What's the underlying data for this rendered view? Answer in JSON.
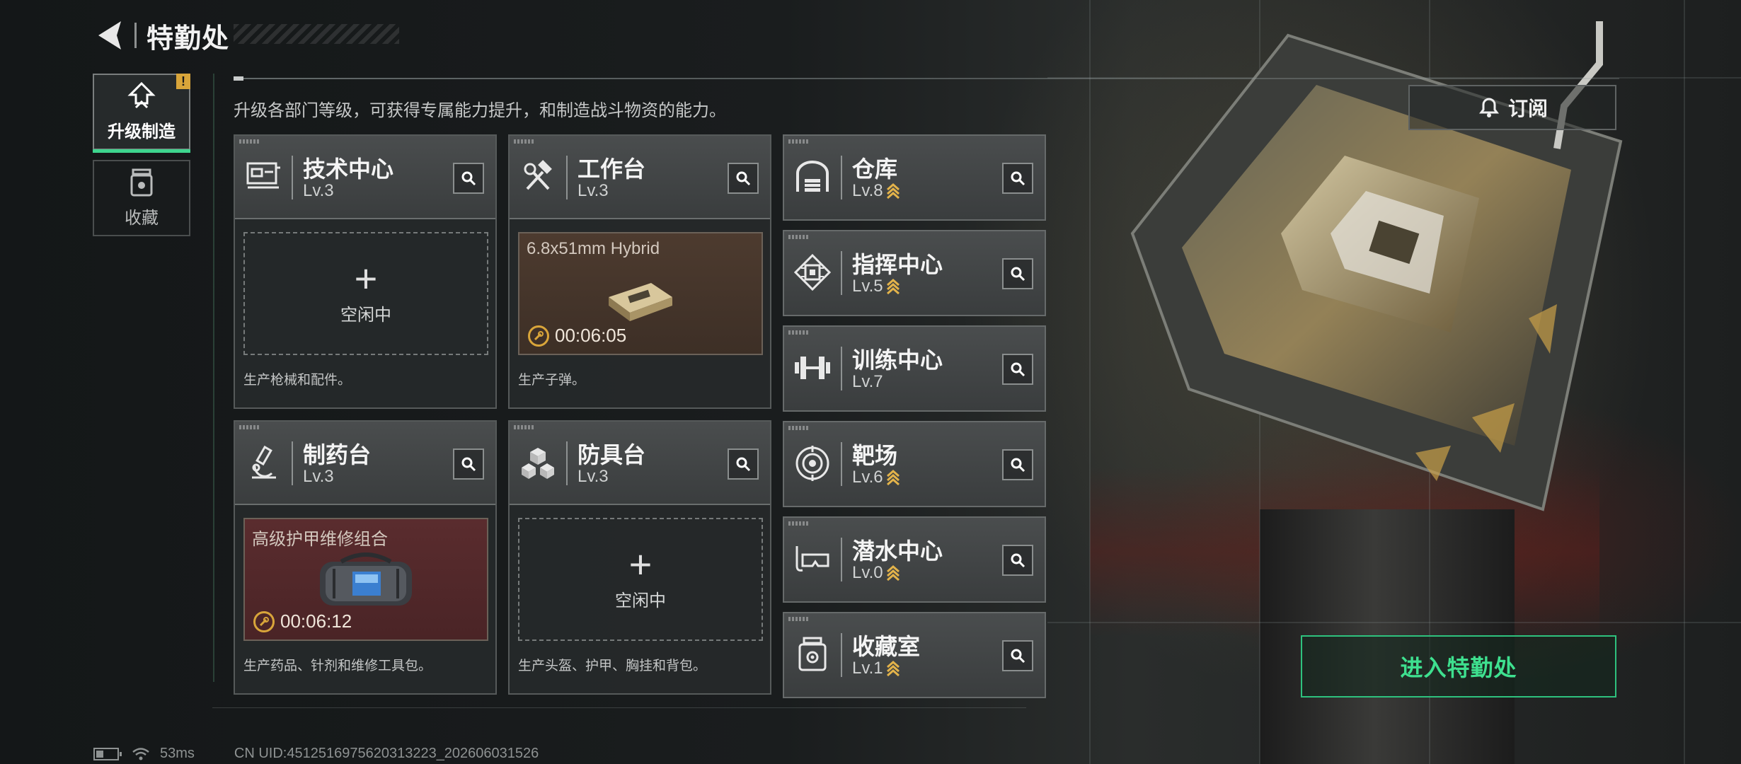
{
  "header": {
    "title": "特勤处"
  },
  "nav": {
    "tabs": [
      {
        "label": "升级制造",
        "active": true,
        "alert": "!"
      },
      {
        "label": "收藏",
        "active": false
      }
    ]
  },
  "description": "升级各部门等级，可获得专属能力提升，和制造战斗物资的能力。",
  "subscribe_label": "订阅",
  "departments_large": [
    {
      "name": "技术中心",
      "level": "Lv.3",
      "icon": "tech-center-icon",
      "slot": {
        "state": "idle",
        "label": "空闲中"
      },
      "desc": "生产枪械和配件。"
    },
    {
      "name": "工作台",
      "level": "Lv.3",
      "icon": "hammer-wrench-icon",
      "slot": {
        "state": "producing",
        "item": "6.8x51mm Hybrid",
        "timer": "00:06:05",
        "tint": "brown"
      },
      "desc": "生产子弹。"
    },
    {
      "name": "制药台",
      "level": "Lv.3",
      "icon": "microscope-icon",
      "slot": {
        "state": "producing",
        "item": "高级护甲维修组合",
        "timer": "00:06:12",
        "tint": "red"
      },
      "desc": "生产药品、针剂和维修工具包。"
    },
    {
      "name": "防具台",
      "level": "Lv.3",
      "icon": "armor-blocks-icon",
      "slot": {
        "state": "idle",
        "label": "空闲中"
      },
      "desc": "生产头盔、护甲、胸挂和背包。"
    }
  ],
  "departments_small": [
    {
      "name": "仓库",
      "level": "Lv.8",
      "icon": "warehouse-icon",
      "upgradable": true
    },
    {
      "name": "指挥中心",
      "level": "Lv.5",
      "icon": "command-chip-icon",
      "upgradable": true
    },
    {
      "name": "训练中心",
      "level": "Lv.7",
      "icon": "dumbbell-icon",
      "upgradable": false
    },
    {
      "name": "靶场",
      "level": "Lv.6",
      "icon": "target-icon",
      "upgradable": true
    },
    {
      "name": "潜水中心",
      "level": "Lv.0",
      "icon": "diving-mask-icon",
      "upgradable": true
    },
    {
      "name": "收藏室",
      "level": "Lv.1",
      "icon": "collection-jar-icon",
      "upgradable": true
    }
  ],
  "enter_label": "进入特勤处",
  "footer": {
    "ping": "53ms",
    "uid": "CN UID:4512516975620313223_202606031526"
  },
  "colors": {
    "accent_green": "#3ee08f",
    "gold": "#d9a53a"
  }
}
